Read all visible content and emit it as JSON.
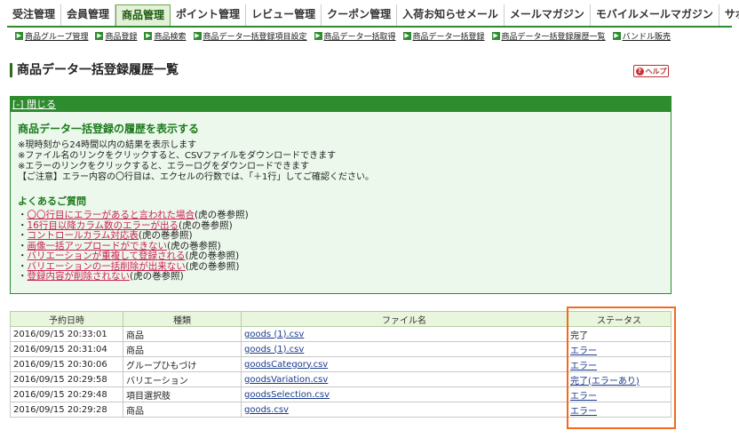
{
  "topnav": {
    "items": [
      "受注管理",
      "会員管理",
      "商品管理",
      "ポイント管理",
      "レビュー管理",
      "クーポン管理",
      "入荷お知らせメール",
      "メールマガジン",
      "モバイルメールマガジン",
      "サポート"
    ]
  },
  "subnav": {
    "items": [
      "商品グループ管理",
      "商品登録",
      "商品検索",
      "商品データ一括登録項目設定",
      "商品データ一括取得",
      "商品データ一括登録",
      "商品データ一括登録履歴一覧",
      "バンドル販売"
    ]
  },
  "page_title": "商品データ一括登録履歴一覧",
  "help_label": "ヘルプ",
  "info": {
    "toggle": "[-] 閉じる",
    "heading": "商品データ一括登録の履歴を表示する",
    "notes": [
      "※現時刻から24時間以内の結果を表示します",
      "※ファイル名のリンクをクリックすると、CSVファイルをダウンロードできます",
      "※エラーのリンクをクリックすると、エラーログをダウンロードできます",
      "【ご注意】エラー内容の〇行目は、エクセルの行数では、「＋1行」してご確認ください。"
    ],
    "faq_heading": "よくあるご質問",
    "faq": [
      {
        "link": "〇〇行目にエラーがあると言われた場合",
        "suffix": "(虎の巻参照)"
      },
      {
        "link": "16行目以降カラム数のエラーが出る",
        "suffix": "(虎の巻参照)"
      },
      {
        "link": "コントロールカラム対応表",
        "suffix": "(虎の巻参照)"
      },
      {
        "link": "画像一括アップロードができない",
        "suffix": "(虎の巻参照)"
      },
      {
        "link": "バリエーションが重複して登録される",
        "suffix": "(虎の巻参照)"
      },
      {
        "link": "バリエーションの一括削除が出来ない",
        "suffix": "(虎の巻参照)"
      },
      {
        "link": "登録内容が削除されない",
        "suffix": "(虎の巻参照)"
      }
    ]
  },
  "table": {
    "headers": [
      "予約日時",
      "種類",
      "ファイル名",
      "ステータス"
    ],
    "rows": [
      [
        "2016/09/15 20:33:01",
        "商品",
        "goods (1).csv",
        "完了"
      ],
      [
        "2016/09/15 20:31:04",
        "商品",
        "goods (1).csv",
        "エラー"
      ],
      [
        "2016/09/15 20:30:06",
        "グループひもづけ",
        "goodsCategory.csv",
        "エラー"
      ],
      [
        "2016/09/15 20:29:58",
        "バリエーション",
        "goodsVariation.csv",
        "完了(エラーあり)"
      ],
      [
        "2016/09/15 20:29:48",
        "項目選択肢",
        "goodsSelection.csv",
        "エラー"
      ],
      [
        "2016/09/15 20:29:28",
        "商品",
        "goods.csv",
        "エラー"
      ]
    ]
  },
  "colors": {
    "accent_green": "#2e8b2e",
    "highlight": "#f26b1d",
    "faq_link": "#cc2255"
  }
}
